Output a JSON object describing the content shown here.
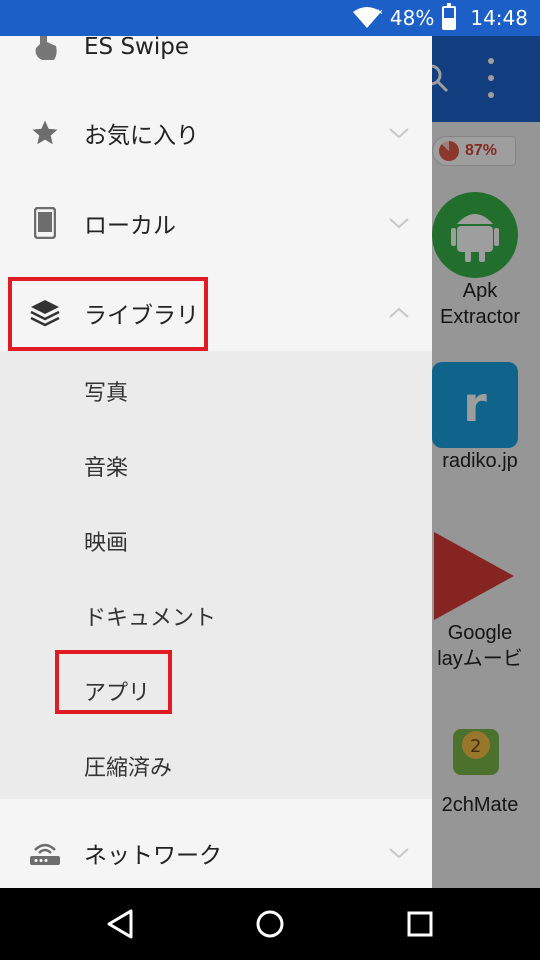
{
  "status_bar": {
    "battery": "48%",
    "time": "14:48"
  },
  "background_app": {
    "usage_percent": "87%",
    "apps": [
      {
        "label_line1": "Apk",
        "label_line2": "Extractor"
      },
      {
        "label_line1": "radiko.jp",
        "label_line2": ""
      },
      {
        "label_line1": "Google",
        "label_line2": "layムービ"
      },
      {
        "label_line1": "2chMate",
        "label_line2": ""
      }
    ]
  },
  "drawer": {
    "items": [
      {
        "label": "ES Swipe",
        "icon": "touch-icon"
      },
      {
        "label": "お気に入り",
        "icon": "star-icon"
      },
      {
        "label": "ローカル",
        "icon": "phone-icon"
      },
      {
        "label": "ライブラリ",
        "icon": "layers-icon"
      }
    ],
    "library_subitems": [
      "写真",
      "音楽",
      "映画",
      "ドキュメント",
      "アプリ",
      "圧縮済み"
    ],
    "network": {
      "label": "ネットワーク",
      "icon": "router-icon"
    }
  },
  "colors": {
    "highlight": "#e01b24",
    "toolbar": "#1e63cc"
  }
}
